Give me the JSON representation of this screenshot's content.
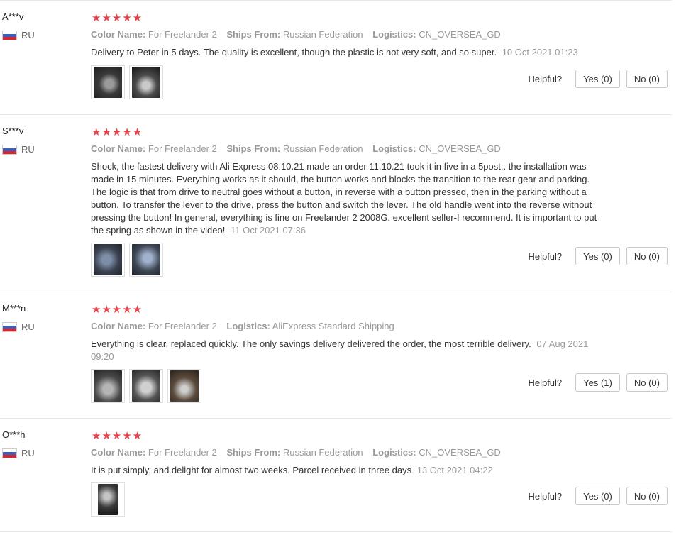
{
  "helpful_label": "Helpful?",
  "reviews": [
    {
      "user": "A***v",
      "country": "RU",
      "stars": "★★★★★",
      "color_label": "Color Name:",
      "color_value": "For Freelander 2",
      "ships_label": "Ships From:",
      "ships_value": "Russian Federation",
      "logistics_label": "Logistics:",
      "logistics_value": "CN_OVERSEA_GD",
      "text": "Delivery to Peter in 5 days. The quality is excellent, though the plastic is not very soft, and so super.",
      "date": "10 Oct 2021 01:23",
      "yes": "Yes (0)",
      "no": "No (0)"
    },
    {
      "user": "S***v",
      "country": "RU",
      "stars": "★★★★★",
      "color_label": "Color Name:",
      "color_value": "For Freelander 2",
      "ships_label": "Ships From:",
      "ships_value": "Russian Federation",
      "logistics_label": "Logistics:",
      "logistics_value": "CN_OVERSEA_GD",
      "text": "Shock, the fastest delivery with Ali Express 08.10.21 made an order 11.10.21 took it in five in a 5post,. the installation was made in 15 minutes. Everything works as it should, the button works and blocks the transition to the rear gear and parking. The logic is that from drive to neutral goes without a button, in reverse with a button pressed, then in the parking without a button. To transfer the lever to the drive, press the button and switch the lever. The old handle went into the reverse without pressing the button! In general, everything is fine on Freelander 2 2008G. excellent seller-I recommend. It is important to put the spring as shown in the video!",
      "date": "11 Oct 2021 07:36",
      "yes": "Yes (0)",
      "no": "No (0)"
    },
    {
      "user": "M***n",
      "country": "RU",
      "stars": "★★★★★",
      "color_label": "Color Name:",
      "color_value": "For Freelander 2",
      "logistics_label": "Logistics:",
      "logistics_value": "AliExpress Standard Shipping",
      "text": "Everything is clear, replaced quickly. The only savings delivery delivered the order, the most terrible delivery.",
      "date": "07 Aug 2021 09:20",
      "yes": "Yes (1)",
      "no": "No (0)"
    },
    {
      "user": "O***h",
      "country": "RU",
      "stars": "★★★★★",
      "color_label": "Color Name:",
      "color_value": "For Freelander 2",
      "ships_label": "Ships From:",
      "ships_value": "Russian Federation",
      "logistics_label": "Logistics:",
      "logistics_value": "CN_OVERSEA_GD",
      "text": "It is put simply, and delight for almost two weeks. Parcel received in three days",
      "date": "13 Oct 2021 04:22",
      "yes": "Yes (0)",
      "no": "No (0)"
    }
  ]
}
